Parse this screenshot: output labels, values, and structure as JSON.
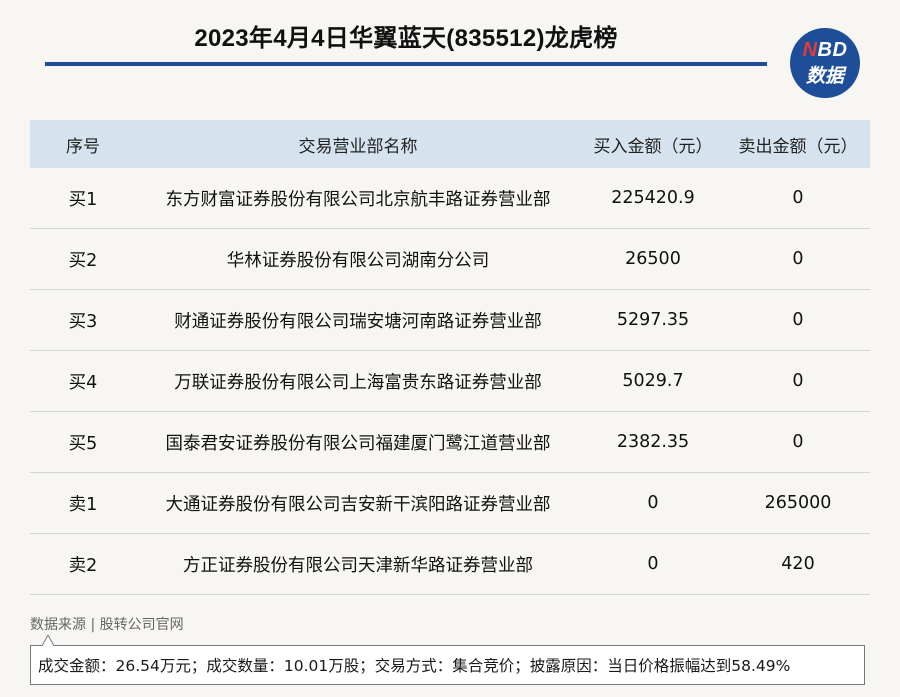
{
  "title": "2023年4月4日华翼蓝天(835512)龙虎榜",
  "logo": {
    "line1_prefix": "N",
    "line1_rest": "BD",
    "line2": "数据"
  },
  "colors": {
    "accent": "#1f4d95",
    "header_bg": "#d6e3ee",
    "logo_red": "#e43a3a"
  },
  "table": {
    "headers": [
      "序号",
      "交易营业部名称",
      "买入金额（元）",
      "卖出金额（元）"
    ],
    "rows": [
      [
        "买1",
        "东方财富证券股份有限公司北京航丰路证券营业部",
        "225420.9",
        "0"
      ],
      [
        "买2",
        "华林证券股份有限公司湖南分公司",
        "26500",
        "0"
      ],
      [
        "买3",
        "财通证券股份有限公司瑞安塘河南路证券营业部",
        "5297.35",
        "0"
      ],
      [
        "买4",
        "万联证券股份有限公司上海富贵东路证券营业部",
        "5029.7",
        "0"
      ],
      [
        "买5",
        "国泰君安证券股份有限公司福建厦门鹭江道营业部",
        "2382.35",
        "0"
      ],
      [
        "卖1",
        "大通证券股份有限公司吉安新干滨阳路证券营业部",
        "0",
        "265000"
      ],
      [
        "卖2",
        "方正证券股份有限公司天津新华路证券营业部",
        "0",
        "420"
      ]
    ]
  },
  "source": "数据来源 | 股转公司官网",
  "note": "成交金额：26.54万元；成交数量：10.01万股；交易方式：集合竞价；披露原因：当日价格振幅达到58.49%"
}
